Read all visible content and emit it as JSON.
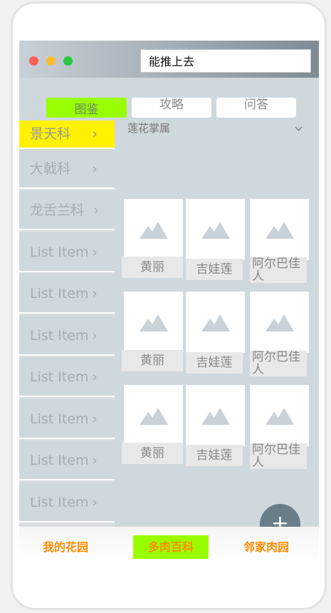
{
  "browser": {
    "url": "能推上去",
    "dot_colors": [
      "#ff5f57",
      "#ffbd2e",
      "#28c940"
    ]
  },
  "tabs": [
    {
      "label": "图鉴",
      "active": true
    },
    {
      "label": "攻略",
      "active": false
    },
    {
      "label": "问答",
      "active": false
    }
  ],
  "sidebar": {
    "items": [
      {
        "label": "景天科",
        "active": true
      },
      {
        "label": "大戟科",
        "active": false
      },
      {
        "label": "龙舌兰科",
        "active": false
      },
      {
        "label": "List Item",
        "active": false
      },
      {
        "label": "List Item",
        "active": false
      },
      {
        "label": "List Item",
        "active": false
      },
      {
        "label": "List Item",
        "active": false
      },
      {
        "label": "List Item",
        "active": false
      },
      {
        "label": "List Item",
        "active": false
      },
      {
        "label": "List Item",
        "active": false
      }
    ],
    "chevron": "›"
  },
  "filter": {
    "label": "莲花掌属",
    "icon": "chevron-down-icon"
  },
  "grid": {
    "rows": [
      [
        "黄丽",
        "吉娃莲",
        "阿尔巴佳人"
      ],
      [
        "黄丽",
        "吉娃莲",
        "阿尔巴佳人"
      ],
      [
        "黄丽",
        "吉娃莲",
        "阿尔巴佳人"
      ]
    ],
    "image_icon": "image-placeholder-icon"
  },
  "fab": {
    "label": "+",
    "icon": "add-icon"
  },
  "bottom_nav": [
    {
      "label": "我的花园",
      "active": false
    },
    {
      "label": "多肉百科",
      "active": true
    },
    {
      "label": "邻家肉园",
      "active": false
    }
  ],
  "colors": {
    "accent_green": "#99ff00",
    "accent_yellow": "#fff200",
    "nav_orange": "#ff8c00",
    "fab": "#6a7e8a"
  }
}
